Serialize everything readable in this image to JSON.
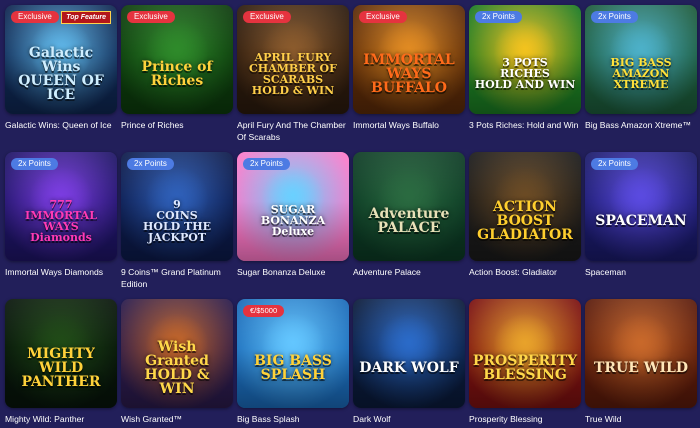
{
  "games": [
    {
      "name": "Galactic Wins: Queen of Ice",
      "badge": "Exclusive",
      "badge_type": "exclusive",
      "extra_badge": "Top Feature",
      "art_text": "Galactic Wins\nQUEEN OF ICE",
      "bg": [
        "#0e2650",
        "#5db4e6"
      ],
      "text_color": "#cfeeff",
      "icon": "snowflake-icon"
    },
    {
      "name": "Prince of Riches",
      "badge": "Exclusive",
      "badge_type": "exclusive",
      "art_text": "Prince of\nRiches",
      "bg": [
        "#0c3a0c",
        "#2e8a2a"
      ],
      "text_color": "#ffd23c",
      "icon": "crown-icon"
    },
    {
      "name": "April Fury And The Chamber Of Scarabs",
      "badge": "Exclusive",
      "badge_type": "exclusive",
      "art_text": "APRIL FURY\nCHAMBER OF SCARABS\nHOLD & WIN",
      "bg": [
        "#2b1a0d",
        "#8a5a2c"
      ],
      "text_color": "#ffcf4a",
      "icon": "scarab-icon"
    },
    {
      "name": "Immortal Ways Buffalo",
      "badge": "Exclusive",
      "badge_type": "exclusive",
      "art_text": "IMMORTAL WAYS\nBUFFALO",
      "bg": [
        "#5a2a08",
        "#e08a22"
      ],
      "text_color": "#ff6a1a",
      "icon": "buffalo-icon"
    },
    {
      "name": "3 Pots Riches: Hold and Win",
      "badge": "2x Points",
      "badge_type": "points",
      "art_text": "3 POTS\nRICHES\nHOLD AND WIN",
      "bg": [
        "#1b7a22",
        "#f2c21e"
      ],
      "text_color": "#ffffff",
      "icon": "pot-icon"
    },
    {
      "name": "Big Bass Amazon Xtreme™",
      "badge": "2x Points",
      "badge_type": "points",
      "art_text": "BIG BASS\nAMAZON\nXTREME",
      "bg": [
        "#1c5a3a",
        "#4cb0c8"
      ],
      "text_color": "#ffe13a",
      "icon": "fish-icon"
    },
    {
      "name": "Immortal Ways Diamonds",
      "badge": "2x Points",
      "badge_type": "points",
      "art_text": "777\nIMMORTAL WAYS\nDiamonds",
      "bg": [
        "#1e1466",
        "#7a3ce0"
      ],
      "text_color": "#ff3ab5",
      "icon": "diamond-icon"
    },
    {
      "name": "9 Coins™ Grand Platinum Edition",
      "badge": "2x Points",
      "badge_type": "points",
      "art_text": "9\nCOINS\nHOLD THE JACKPOT",
      "bg": [
        "#0c1a4a",
        "#2e5fb8"
      ],
      "text_color": "#dfe9ff",
      "icon": "coin-icon"
    },
    {
      "name": "Sugar Bonanza Deluxe",
      "badge": "2x Points",
      "badge_type": "points",
      "art_text": "SUGAR\nBONANZA\nDeluxe",
      "bg": [
        "#ff78c8",
        "#6ad0ff"
      ],
      "text_color": "#ffffff",
      "icon": "candy-icon"
    },
    {
      "name": "Adventure Palace",
      "badge": "",
      "badge_type": "",
      "art_text": "Adventure\nPALACE",
      "bg": [
        "#0c3a24",
        "#2a6a40"
      ],
      "text_color": "#e8e1b8",
      "icon": "palace-icon"
    },
    {
      "name": "Action Boost: Gladiator",
      "badge": "",
      "badge_type": "",
      "art_text": "ACTION BOOST\nGLADIATOR",
      "bg": [
        "#1a1a1a",
        "#6a4a24"
      ],
      "text_color": "#ffcf2e",
      "icon": "helmet-icon"
    },
    {
      "name": "Spaceman",
      "badge": "2x Points",
      "badge_type": "points",
      "art_text": "SPACEMAN",
      "bg": [
        "#1a1a6a",
        "#5a4ae0"
      ],
      "text_color": "#ffffff",
      "icon": "astronaut-icon"
    },
    {
      "name": "Mighty Wild: Panther",
      "badge": "",
      "badge_type": "",
      "art_text": "MIGHTY WILD\nPANTHER",
      "bg": [
        "#07140a",
        "#1f4a16"
      ],
      "text_color": "#ffd23a",
      "icon": "panther-icon"
    },
    {
      "name": "Wish Granted™",
      "badge": "",
      "badge_type": "",
      "art_text": "Wish Granted\nHOLD & WIN",
      "bg": [
        "#2a1a4a",
        "#c0642a"
      ],
      "text_color": "#ffd84a",
      "icon": "lamp-icon"
    },
    {
      "name": "Big Bass Splash",
      "badge": "€/$5000",
      "badge_type": "jackpot",
      "art_text": "BIG BASS\nSPLASH",
      "bg": [
        "#1a6ab8",
        "#63c6ff"
      ],
      "text_color": "#ffd23a",
      "icon": "fisherman-icon"
    },
    {
      "name": "Dark Wolf",
      "badge": "",
      "badge_type": "",
      "art_text": "DARK WOLF",
      "bg": [
        "#0a1a3a",
        "#2a6ac8"
      ],
      "text_color": "#ffffff",
      "icon": "wolf-icon"
    },
    {
      "name": "Prosperity Blessing",
      "badge": "",
      "badge_type": "",
      "art_text": "PROSPERITY\nBLESSING",
      "bg": [
        "#7a1010",
        "#e8a22a"
      ],
      "text_color": "#ffd84a",
      "icon": "coin-icon"
    },
    {
      "name": "True Wild",
      "badge": "",
      "badge_type": "",
      "art_text": "TRUE WILD",
      "bg": [
        "#5a1a0a",
        "#c8682a"
      ],
      "text_color": "#ffe6b8",
      "icon": "cowboy-icon"
    }
  ]
}
